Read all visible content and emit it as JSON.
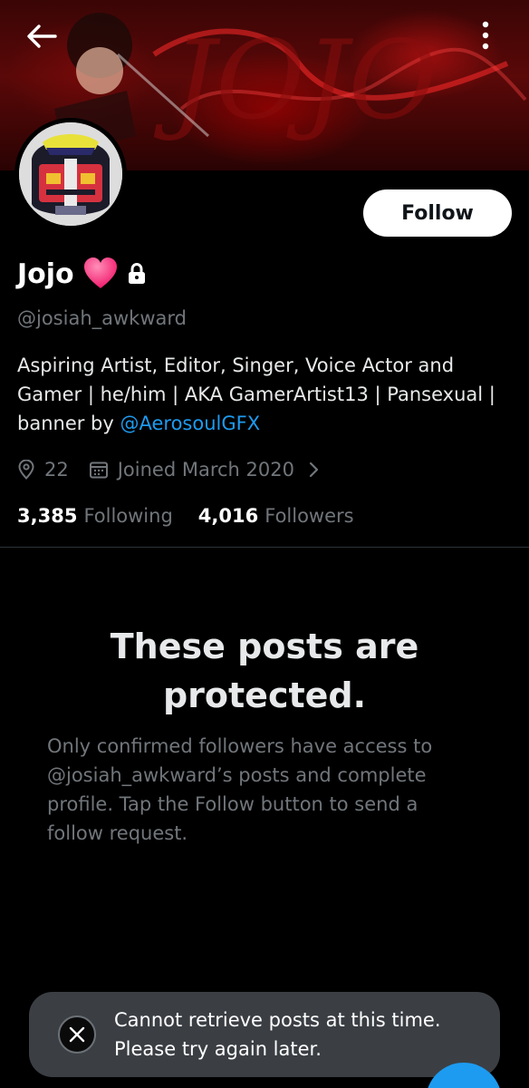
{
  "header": {
    "back_icon": "arrow-left-icon",
    "more_icon": "vertical-dots-icon"
  },
  "profile": {
    "display_name": "Jojo",
    "badges": [
      "heart-icon",
      "lock-icon"
    ],
    "handle": "@josiah_awkward",
    "follow_label": "Follow",
    "bio_text": "Aspiring Artist, Editor, Singer, Voice Actor and Gamer | he/him | AKA GamerArtist13 | Pansexual | banner by ",
    "bio_mention": "@AerosoulGFX",
    "location": "22",
    "joined": "Joined March 2020",
    "following_count": "3,385",
    "following_label": "Following",
    "followers_count": "4,016",
    "followers_label": "Followers"
  },
  "protected": {
    "title": "These posts are protected.",
    "description": "Only confirmed followers have access to @josiah_awkward’s posts and complete profile. Tap the Follow button to send a follow request."
  },
  "toast": {
    "icon": "x-logo-icon",
    "line1": "Cannot retrieve posts at this time.",
    "line2": "Please try again later."
  },
  "colors": {
    "background": "#000000",
    "primary_text": "#e7e9ea",
    "secondary_text": "#71767b",
    "link": "#1d9bf0",
    "heart": "#f91880",
    "toast_bg": "#3b3f44"
  }
}
